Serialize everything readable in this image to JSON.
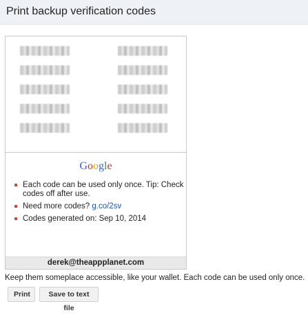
{
  "header": {
    "title": "Print backup verification codes"
  },
  "card": {
    "codes_left_count": 5,
    "codes_right_count": 5,
    "logo": {
      "text": "Google",
      "letters": [
        {
          "ch": "G",
          "color": "#3366cc"
        },
        {
          "ch": "o",
          "color": "#cc3333"
        },
        {
          "ch": "o",
          "color": "#e6a800"
        },
        {
          "ch": "g",
          "color": "#3366cc"
        },
        {
          "ch": "l",
          "color": "#339933"
        },
        {
          "ch": "e",
          "color": "#cc3333"
        }
      ]
    },
    "bullets": {
      "item1": "Each code can be used only once. Tip: Check codes off after use.",
      "item2_text": "Need more codes? ",
      "item2_link": "g.co/2sv",
      "item3": "Codes generated on: Sep 10, 2014"
    },
    "email": "derek@theappplanet.com"
  },
  "note": "Keep them someplace accessible, like your wallet. Each code can be used only once.",
  "buttons": {
    "print": "Print",
    "save": "Save to text file"
  },
  "colors": {
    "header_bg": "#eef1f5",
    "bullet": "#d14836",
    "link": "#1155cc"
  }
}
